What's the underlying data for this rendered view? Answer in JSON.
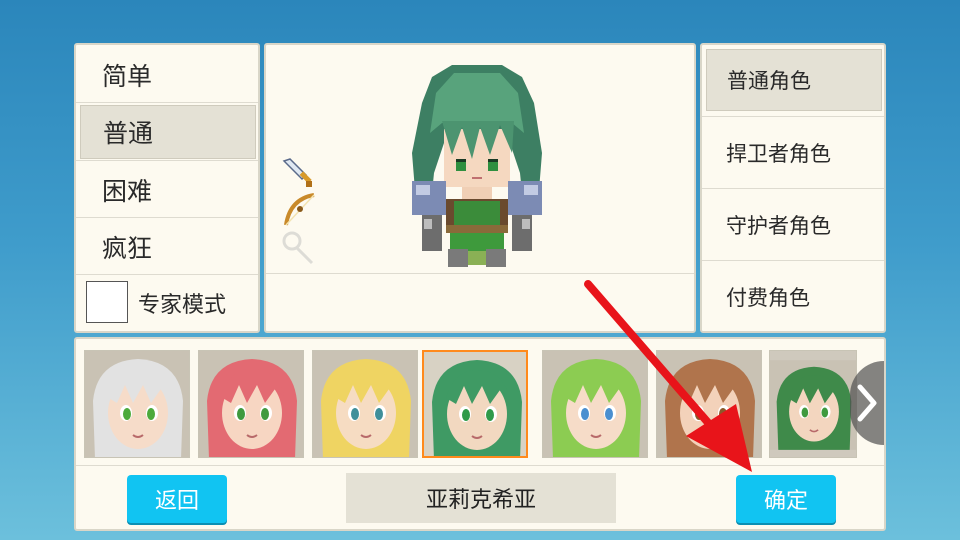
{
  "difficulty": {
    "items": [
      {
        "label": "简单",
        "selected": false
      },
      {
        "label": "普通",
        "selected": true
      },
      {
        "label": "困难",
        "selected": false
      },
      {
        "label": "疯狂",
        "selected": false
      }
    ],
    "expert_mode_label": "专家模式",
    "expert_mode_checked": false
  },
  "preview": {
    "sprite": "green-haired-character-sprite",
    "equipment_icons": [
      "sword-icon",
      "bow-icon",
      "staff-icon"
    ]
  },
  "roles": {
    "items": [
      {
        "label": "普通角色",
        "selected": true
      },
      {
        "label": "捍卫者角色",
        "selected": false
      },
      {
        "label": "守护者角色",
        "selected": false
      },
      {
        "label": "付费角色",
        "selected": false
      }
    ]
  },
  "characters": {
    "portraits": [
      {
        "hair": "#e2e2e2",
        "skin": "#f6dcc9",
        "eyes": "#4caa3c",
        "selected": false
      },
      {
        "hair": "#e36a72",
        "skin": "#f7d6c2",
        "eyes": "#3f9a3f",
        "selected": false
      },
      {
        "hair": "#efd462",
        "skin": "#f6dcc2",
        "eyes": "#3f8f9a",
        "selected": false
      },
      {
        "hair": "#3f9a64",
        "skin": "#f2d8c0",
        "eyes": "#2f9a4a",
        "selected": true
      },
      {
        "hair": "#8ccc52",
        "skin": "#f6dcc8",
        "eyes": "#4a8fd0",
        "selected": false
      },
      {
        "hair": "#b0744c",
        "skin": "#f3d2ba",
        "eyes": "#8a5a2a",
        "selected": false
      },
      {
        "hair": "#3f8a4a",
        "skin": "#f3d6bf",
        "eyes": "#3f9a3f",
        "selected": false
      }
    ],
    "selected_name": "亚莉克希亚"
  },
  "buttons": {
    "back": "返回",
    "confirm": "确定"
  },
  "colors": {
    "accent_button": "#11c4f2",
    "selection_outline": "#ff8a1c",
    "annotation_arrow": "#e8141a"
  }
}
